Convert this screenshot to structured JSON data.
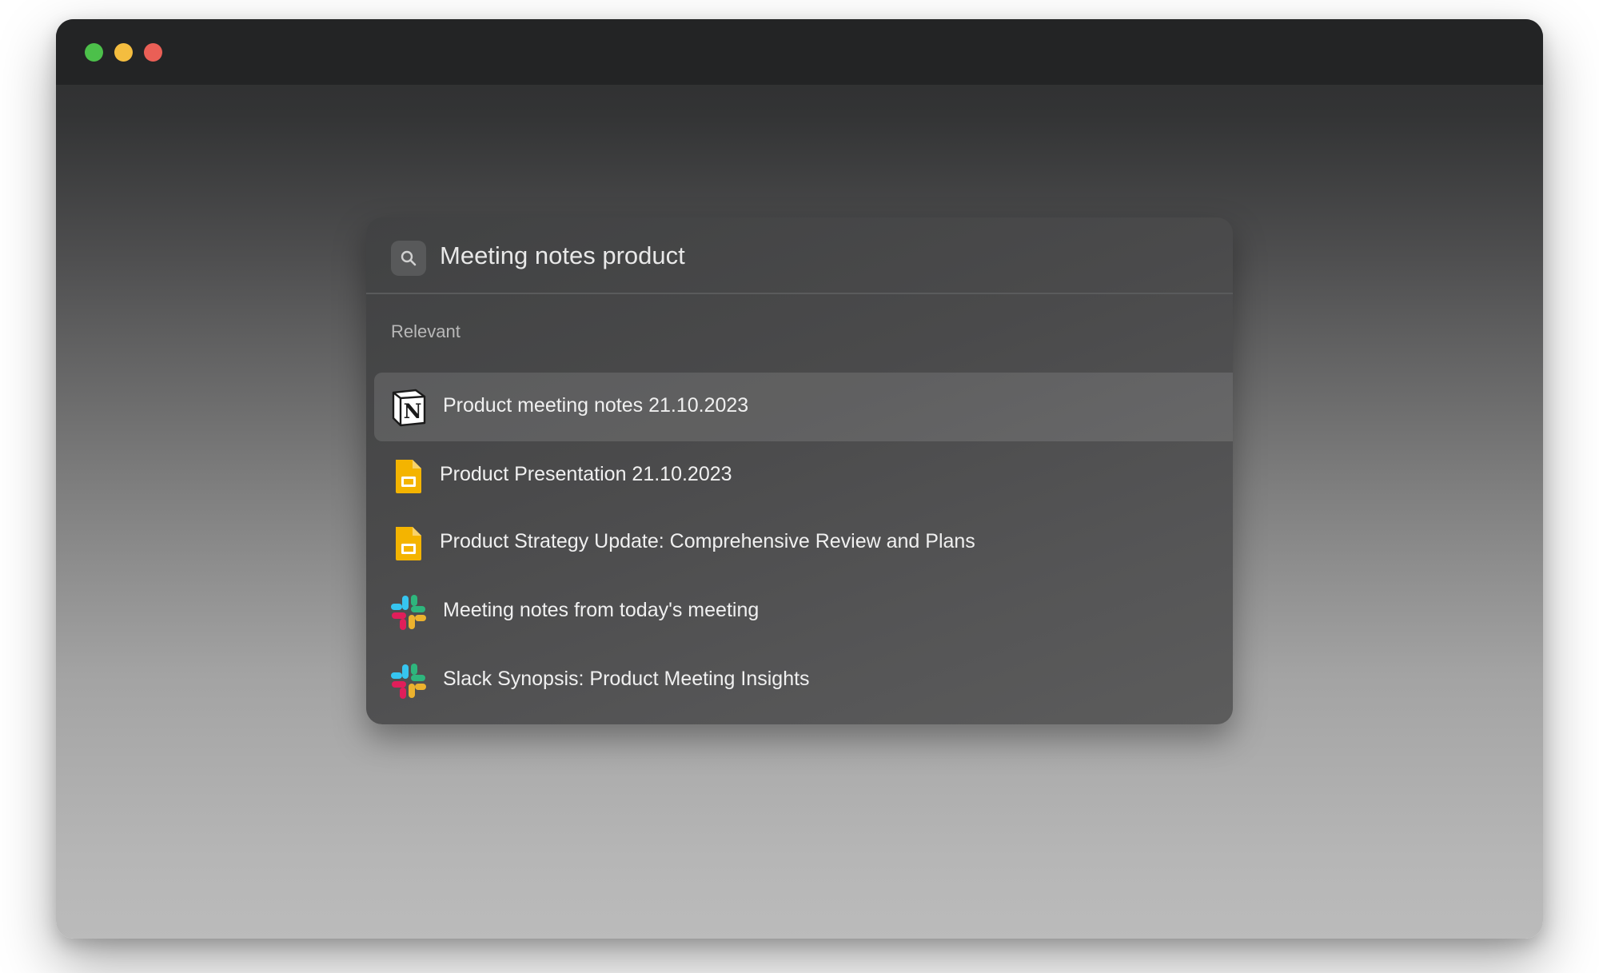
{
  "window": {
    "controls": [
      {
        "name": "green",
        "color": "#4cc04a"
      },
      {
        "name": "yellow",
        "color": "#f4bd3f"
      },
      {
        "name": "red",
        "color": "#ea5f56"
      }
    ]
  },
  "search": {
    "icon": "search-icon",
    "value": "Meeting notes product"
  },
  "results": {
    "section_label": "Relevant",
    "items": [
      {
        "label": "Product meeting notes 21.10.2023",
        "icon": "notion-icon",
        "selected": true
      },
      {
        "label": "Product Presentation 21.10.2023",
        "icon": "google-slides-icon",
        "selected": false
      },
      {
        "label": "Product Strategy Update: Comprehensive Review and Plans",
        "icon": "google-slides-icon",
        "selected": false
      },
      {
        "label": "Meeting notes from today's meeting",
        "icon": "slack-icon",
        "selected": false
      },
      {
        "label": "Slack Synopsis: Product Meeting Insights",
        "icon": "slack-icon",
        "selected": false
      }
    ]
  },
  "colors": {
    "slides_yellow": "#f4b400",
    "slack_blue": "#36c5f0",
    "slack_green": "#2eb67d",
    "slack_red": "#e01e5a",
    "slack_yellow": "#ecb22e"
  }
}
